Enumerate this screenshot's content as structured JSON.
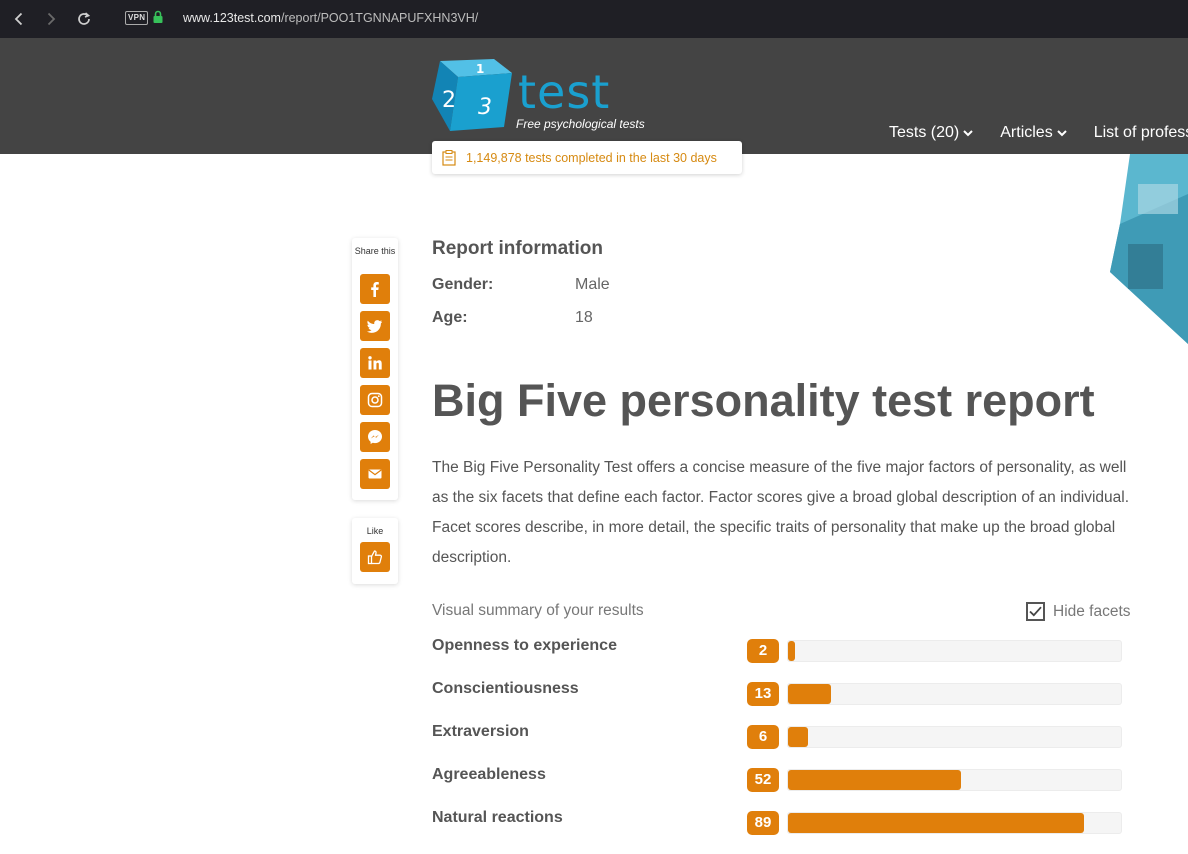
{
  "browser": {
    "url_domain": "www.123test.com",
    "url_path": "/report/POO1TGNNAPUFXHN3VH/",
    "vpn_label": "VPN",
    "icons": [
      "back-icon",
      "forward-icon",
      "reload-icon",
      "lock-icon"
    ]
  },
  "header": {
    "logo_word": "test",
    "logo_tagline": "Free psychological tests",
    "logo_digits": [
      "1",
      "2",
      "3"
    ],
    "nav": [
      {
        "label": "Tests (20)"
      },
      {
        "label": "Articles"
      },
      {
        "label": "List of profess"
      }
    ],
    "counter_text": "1,149,878 tests completed in the last 30 days"
  },
  "share": {
    "title": "Share this",
    "buttons": [
      "facebook-icon",
      "twitter-icon",
      "linkedin-icon",
      "instagram-icon",
      "messenger-icon",
      "email-icon"
    ],
    "like_label": "Like"
  },
  "report_info": {
    "title": "Report information",
    "rows": [
      {
        "label": "Gender:",
        "value": "Male"
      },
      {
        "label": "Age:",
        "value": "18"
      }
    ]
  },
  "main": {
    "title": "Big Five personality test report",
    "intro": "The Big Five Personality Test offers a concise measure of the five major factors of personality, as well as the six facets that define each factor. Factor scores give a broad global description of an individual. Facet scores describe, in more detail, the specific traits of personality that make up the broad global description.",
    "summary_label": "Visual summary of your results",
    "hide_facets_label": "Hide facets",
    "hide_facets_checked": true,
    "results": [
      {
        "name": "Openness to experience",
        "score": "2",
        "percent": 2
      },
      {
        "name": "Conscientiousness",
        "score": "13",
        "percent": 13
      },
      {
        "name": "Extraversion",
        "score": "6",
        "percent": 6
      },
      {
        "name": "Agreeableness",
        "score": "52",
        "percent": 52
      },
      {
        "name": "Natural reactions",
        "score": "89",
        "percent": 89
      }
    ]
  },
  "colors": {
    "accent": "#e07f0b",
    "brand_blue": "#1aa0cf",
    "header_bg": "#444444",
    "browser_bg": "#1f1f25"
  }
}
